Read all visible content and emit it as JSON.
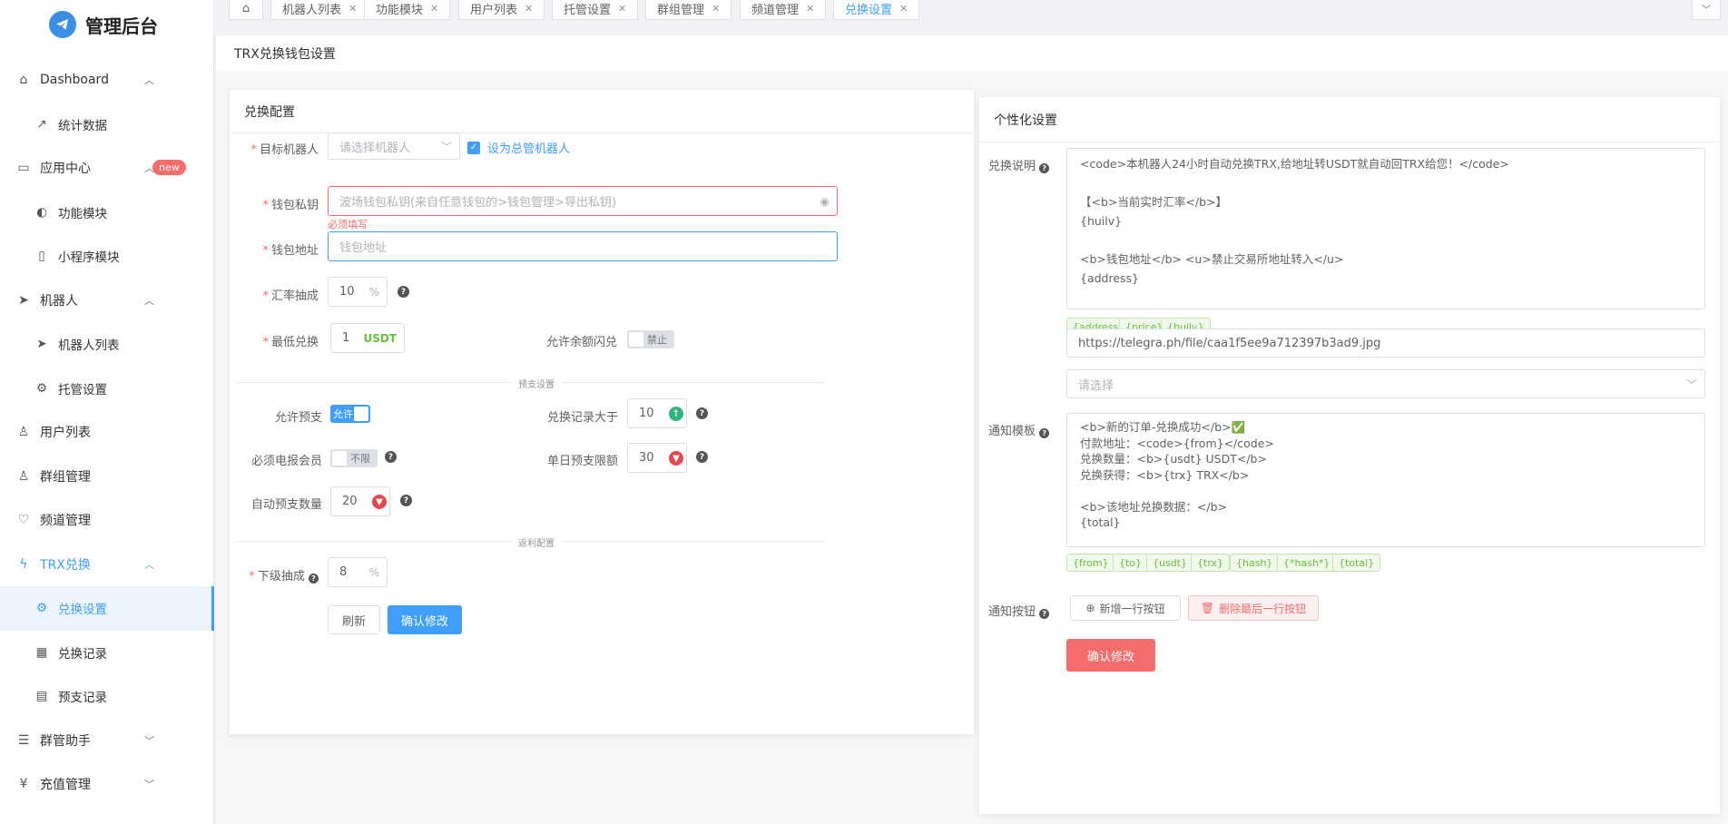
{
  "app": {
    "title": "管理后台"
  },
  "nav": {
    "dashboard": "Dashboard",
    "stats": "统计数据",
    "app_center": "应用中心",
    "app_center_badge": "new",
    "func_module": "功能模块",
    "mini_module": "小程序模块",
    "robot": "机器人",
    "robot_list": "机器人列表",
    "hosting": "托管设置",
    "users": "用户列表",
    "groups": "群组管理",
    "channels": "频道管理",
    "trx": "TRX兑换",
    "exchange_settings": "兑换设置",
    "exchange_records": "兑换记录",
    "advance_records": "预支记录",
    "group_helper": "群管助手",
    "recharge": "充值管理"
  },
  "tabs": [
    "机器人列表",
    "功能模块",
    "用户列表",
    "托管设置",
    "群组管理",
    "频道管理",
    "兑换设置"
  ],
  "page": {
    "title": "TRX兑换钱包设置"
  },
  "left": {
    "title": "兑换配置",
    "target_robot_label": "目标机器人",
    "target_robot_placeholder": "请选择机器人",
    "set_master_label": "设为总管机器人",
    "wallet_key_label": "钱包私钥",
    "wallet_key_placeholder": "波场钱包私钥(来自任意钱包的>钱包管理>导出私钥)",
    "wallet_key_error": "必须填写",
    "wallet_addr_label": "钱包地址",
    "wallet_addr_placeholder": "钱包地址",
    "rate_cut_label": "汇率抽成",
    "rate_cut_value": "10",
    "percent": "%",
    "min_exchange_label": "最低兑换",
    "min_exchange_value": "1",
    "min_exchange_unit": "USDT",
    "allow_flash_label": "允许余额闪兑",
    "allow_flash_state": "禁止",
    "advance_divider": "预支设置",
    "allow_advance_label": "允许预支",
    "allow_advance_state": "允许",
    "records_gt_label": "兑换记录大于",
    "records_gt_value": "10",
    "must_premium_label": "必须电报会员",
    "must_premium_state": "不限",
    "daily_limit_label": "单日预支限额",
    "daily_limit_value": "30",
    "auto_advance_label": "自动预支数量",
    "auto_advance_value": "20",
    "commission_divider": "返利配置",
    "sub_cut_label": "下级抽成",
    "sub_cut_value": "8",
    "refresh_btn": "刷新",
    "confirm_btn": "确认修改"
  },
  "right": {
    "title": "个性化设置",
    "desc_label": "兑换说明",
    "desc_text": "<code>本机器人24小时自动兑换TRX,给地址转USDT就自动回TRX给您！</code>\n\n【<b>当前实时汇率</b>】\n{huilv}\n\n<b>钱包地址</b> <u>禁止交易所地址转入</u>\n{address}",
    "desc_tags": [
      "{address}",
      "{price}",
      "{huilv}"
    ],
    "image_url": "https://telegra.ph/file/caa1f5ee9a712397b3ad9.jpg",
    "select_placeholder": "请选择",
    "notify_label": "通知模板",
    "notify_text": "<b>新的订单-兑换成功</b>✅\n付款地址：<code>{from}</code>\n兑换数量：<b>{usdt} USDT</b>\n兑换获得：<b>{trx} TRX</b>\n\n<b>该地址兑换数据：</b>\n{total}",
    "notify_tags": [
      "{from}",
      "{to}",
      "{usdt}",
      "{trx}",
      "{hash}",
      "{*hash*}",
      "{total}"
    ],
    "notify_btn_label": "通知按钮",
    "add_row_btn": "新增一行按钮",
    "del_row_btn": "删除最后一行按钮",
    "confirm_btn": "确认修改"
  },
  "colors": {
    "primary": "#409eff",
    "danger": "#f56c6c",
    "success": "#67c23a"
  }
}
